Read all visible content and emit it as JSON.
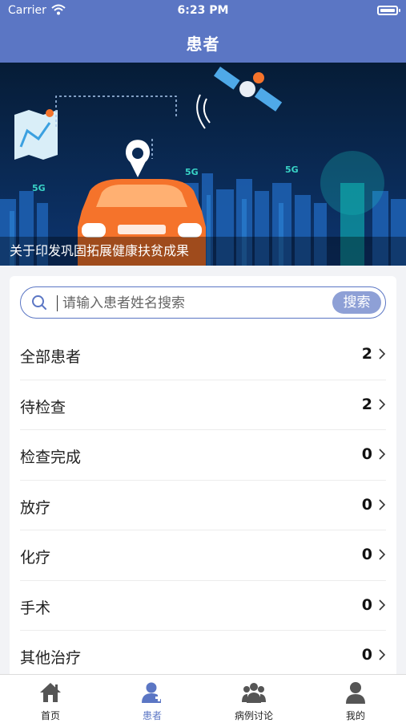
{
  "status_bar": {
    "carrier": "Carrier",
    "time": "6:23 PM"
  },
  "nav": {
    "title": "患者"
  },
  "banner": {
    "caption": "关于印发巩固拓展健康扶贫成果",
    "badge_5g": "5G"
  },
  "search": {
    "placeholder": "请输入患者姓名搜索",
    "button": "搜索"
  },
  "categories": [
    {
      "label": "全部患者",
      "count": "2"
    },
    {
      "label": "待检查",
      "count": "2"
    },
    {
      "label": "检查完成",
      "count": "0"
    },
    {
      "label": "放疗",
      "count": "0"
    },
    {
      "label": "化疗",
      "count": "0"
    },
    {
      "label": "手术",
      "count": "0"
    },
    {
      "label": "其他治疗",
      "count": "0"
    }
  ],
  "tabs": [
    {
      "label": "首页",
      "icon": "home-icon"
    },
    {
      "label": "患者",
      "icon": "patient-icon",
      "active": true
    },
    {
      "label": "病例讨论",
      "icon": "group-icon"
    },
    {
      "label": "我的",
      "icon": "profile-icon"
    }
  ],
  "colors": {
    "primary": "#5b76c4",
    "search_button": "#8ea0d6",
    "banner_bg": "#0a2a55",
    "car": "#f5732b"
  }
}
